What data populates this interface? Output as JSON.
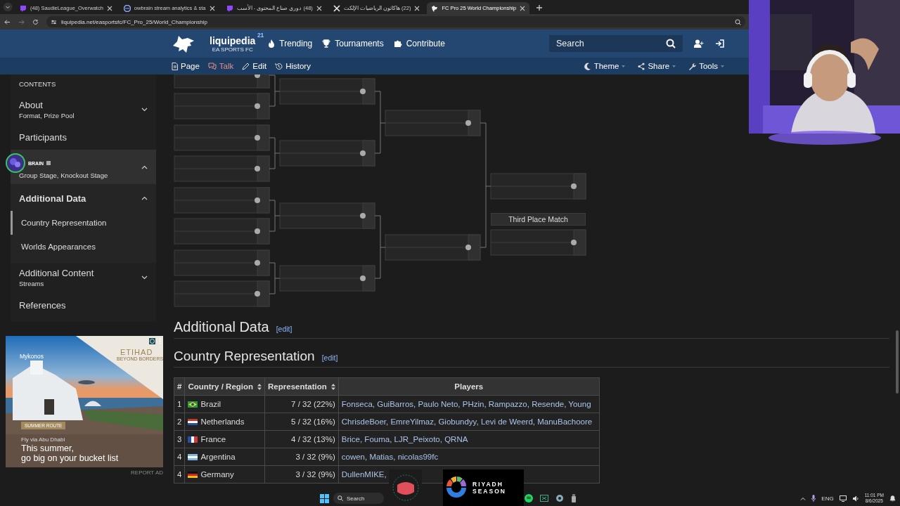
{
  "browser": {
    "tabs": [
      {
        "title": "(48) SaudieLeague_Overwatch",
        "kind": "twitch",
        "selected": false
      },
      {
        "title": "owbrain stream analytics & sta",
        "kind": "owbrain",
        "selected": false
      },
      {
        "title": "(48) دوري صناع المحتوى - الأسب",
        "kind": "twitch",
        "selected": false
      },
      {
        "title": "(22) هاكاثون الرياضيات الإلكت",
        "kind": "x",
        "selected": false
      },
      {
        "title": "FC Pro 25 World Championship",
        "kind": "liquipedia",
        "selected": true
      }
    ],
    "url": "liquipedia.net/easportsfc/FC_Pro_25/World_Championship"
  },
  "site": {
    "name": "liquipedia",
    "badge": "21",
    "wiki": "EA SPORTS FC",
    "nav": [
      {
        "label": "Trending",
        "kind": "trending"
      },
      {
        "label": "Tournaments",
        "kind": "trophy"
      },
      {
        "label": "Contribute",
        "kind": "puzzle"
      }
    ],
    "search": {
      "placeholder": "Search"
    },
    "page_tabs": [
      {
        "label": "Page",
        "kind": "page",
        "missing": false
      },
      {
        "label": "Talk",
        "kind": "talk",
        "missing": true
      },
      {
        "label": "Edit",
        "kind": "edit",
        "missing": false
      },
      {
        "label": "History",
        "kind": "history",
        "missing": false
      }
    ],
    "page_tools": [
      {
        "label": "Theme",
        "kind": "theme"
      },
      {
        "label": "Share",
        "kind": "share"
      },
      {
        "label": "Tools",
        "kind": "tools"
      }
    ]
  },
  "toc": {
    "heading": "CONTENTS",
    "items": [
      {
        "title": "About",
        "subtitle": "Format, Prize Pool",
        "expanded": false,
        "highlighted": false,
        "current": false
      },
      {
        "title": "Participants",
        "highlighted": false,
        "current": false
      },
      {
        "subtitle": "Group Stage, Knockout Stage",
        "expanded": true,
        "highlighted": true
      },
      {
        "title": "Additional Data",
        "expanded": true,
        "highlighted": false,
        "current": true,
        "children": [
          {
            "title": "Country Representation",
            "selected": true
          },
          {
            "title": "Worlds Appearances",
            "selected": false
          }
        ]
      },
      {
        "title": "Additional Content",
        "subtitle": "Streams",
        "expanded": false,
        "highlighted": false,
        "current": false
      },
      {
        "title": "References",
        "highlighted": false,
        "current": false
      }
    ]
  },
  "ad": {
    "kind": "picture",
    "place": "Mykonos",
    "brand": "ETIHAD",
    "slogan": "BEYOND BORDERS",
    "tag": "SUMMER ROUTE",
    "line": "Fly via Abu Dhabi",
    "headline": "This summer,",
    "headline_2": "go big on your bucket list",
    "report": "REPORT AD"
  },
  "bracket": {
    "third_place_label": "Third Place Match"
  },
  "sections": [
    {
      "title": "Additional Data",
      "edit": "[edit]",
      "kind": "h2"
    },
    {
      "title": "Country Representation",
      "edit": "[edit]",
      "kind": "h3"
    }
  ],
  "table": {
    "columns": [
      {
        "label": "#",
        "sortable": false
      },
      {
        "label": "Country / Region",
        "sortable": true
      },
      {
        "label": "Representation",
        "sortable": true
      },
      {
        "label": "Players",
        "sortable": false
      }
    ],
    "rows": [
      {
        "rank": "1",
        "country": "Brazil",
        "kind": "br",
        "representation": "7 / 32 (22%)",
        "players": "Fonseca, GuiBarros, Paulo Neto, PHzin, Rampazzo, Resende, Young"
      },
      {
        "rank": "2",
        "country": "Netherlands",
        "kind": "nl",
        "representation": "5 / 32 (16%)",
        "players": "ChrisdeBoer, EmreYilmaz, Giobundyy, Levi de Weerd, ManuBachoore"
      },
      {
        "rank": "3",
        "country": "France",
        "kind": "fr",
        "representation": "4 / 32 (13%)",
        "players": "Brice, Fouma, LJR_Peixoto, QRNA"
      },
      {
        "rank": "4",
        "country": "Argentina",
        "kind": "ar",
        "representation": "3 / 32 (9%)",
        "players": "cowen, Matias, nicolas99fc"
      },
      {
        "rank": "4",
        "country": "Germany",
        "kind": "de",
        "representation": "3 / 32 (9%)",
        "players": "DullenMIKE,"
      }
    ]
  },
  "overlay": {
    "brain_label": "BRAIN",
    "sponsor": [
      "RIYADH",
      "SEASON"
    ]
  },
  "taskbar": {
    "search": "Search",
    "language": "ENG",
    "time": "11:01 PM",
    "date": "8/6/2025"
  }
}
